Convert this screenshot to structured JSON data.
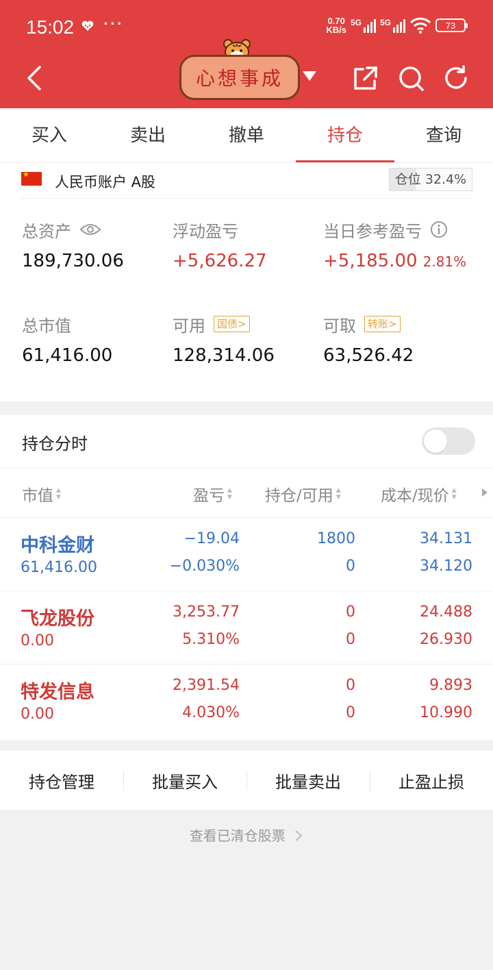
{
  "status_bar": {
    "time": "15:02",
    "net_speed_value": "0.70",
    "net_speed_unit": "KB/s",
    "sim1": "5G",
    "sim2": "5G",
    "battery": "73"
  },
  "header": {
    "logo_text": "心想事成"
  },
  "tabs": [
    {
      "label": "买入"
    },
    {
      "label": "卖出"
    },
    {
      "label": "撤单"
    },
    {
      "label": "持仓",
      "active": true
    },
    {
      "label": "查询"
    }
  ],
  "account": {
    "name": "人民币账户 A股",
    "position_label": "仓位 32.4%",
    "position_ratio": 0.324
  },
  "stats": {
    "total_assets_label": "总资产",
    "total_assets": "189,730.06",
    "floating_pl_label": "浮动盈亏",
    "floating_pl": "+5,626.27",
    "daily_pl_label": "当日参考盈亏",
    "daily_pl": "+5,185.00",
    "daily_pl_pct": "2.81%",
    "market_value_label": "总市值",
    "market_value": "61,416.00",
    "available_label": "可用",
    "available_tag": "国债>",
    "available": "128,314.06",
    "withdrawable_label": "可取",
    "withdrawable_tag": "转账>",
    "withdrawable": "63,526.42"
  },
  "holdings": {
    "title": "持仓分时",
    "toggle_on": false,
    "columns": [
      "市值",
      "盈亏",
      "持仓/可用",
      "成本/现价"
    ],
    "rows": [
      {
        "name": "中科金财",
        "market_value": "61,416.00",
        "pl": "−19.04",
        "pl_pct": "−0.030%",
        "hold": "1800",
        "avail": "0",
        "cost": "34.131",
        "price": "34.120",
        "color": "#3a72c4"
      },
      {
        "name": "飞龙股份",
        "market_value": "0.00",
        "pl": "3,253.77",
        "pl_pct": "5.310%",
        "hold": "0",
        "avail": "0",
        "cost": "24.488",
        "price": "26.930",
        "color": "#cf3b37"
      },
      {
        "name": "特发信息",
        "market_value": "0.00",
        "pl": "2,391.54",
        "pl_pct": "4.030%",
        "hold": "0",
        "avail": "0",
        "cost": "9.893",
        "price": "10.990",
        "color": "#cf3b37"
      }
    ]
  },
  "actions": [
    "持仓管理",
    "批量买入",
    "批量卖出",
    "止盈止损"
  ],
  "cleared_link": "查看已清仓股票"
}
